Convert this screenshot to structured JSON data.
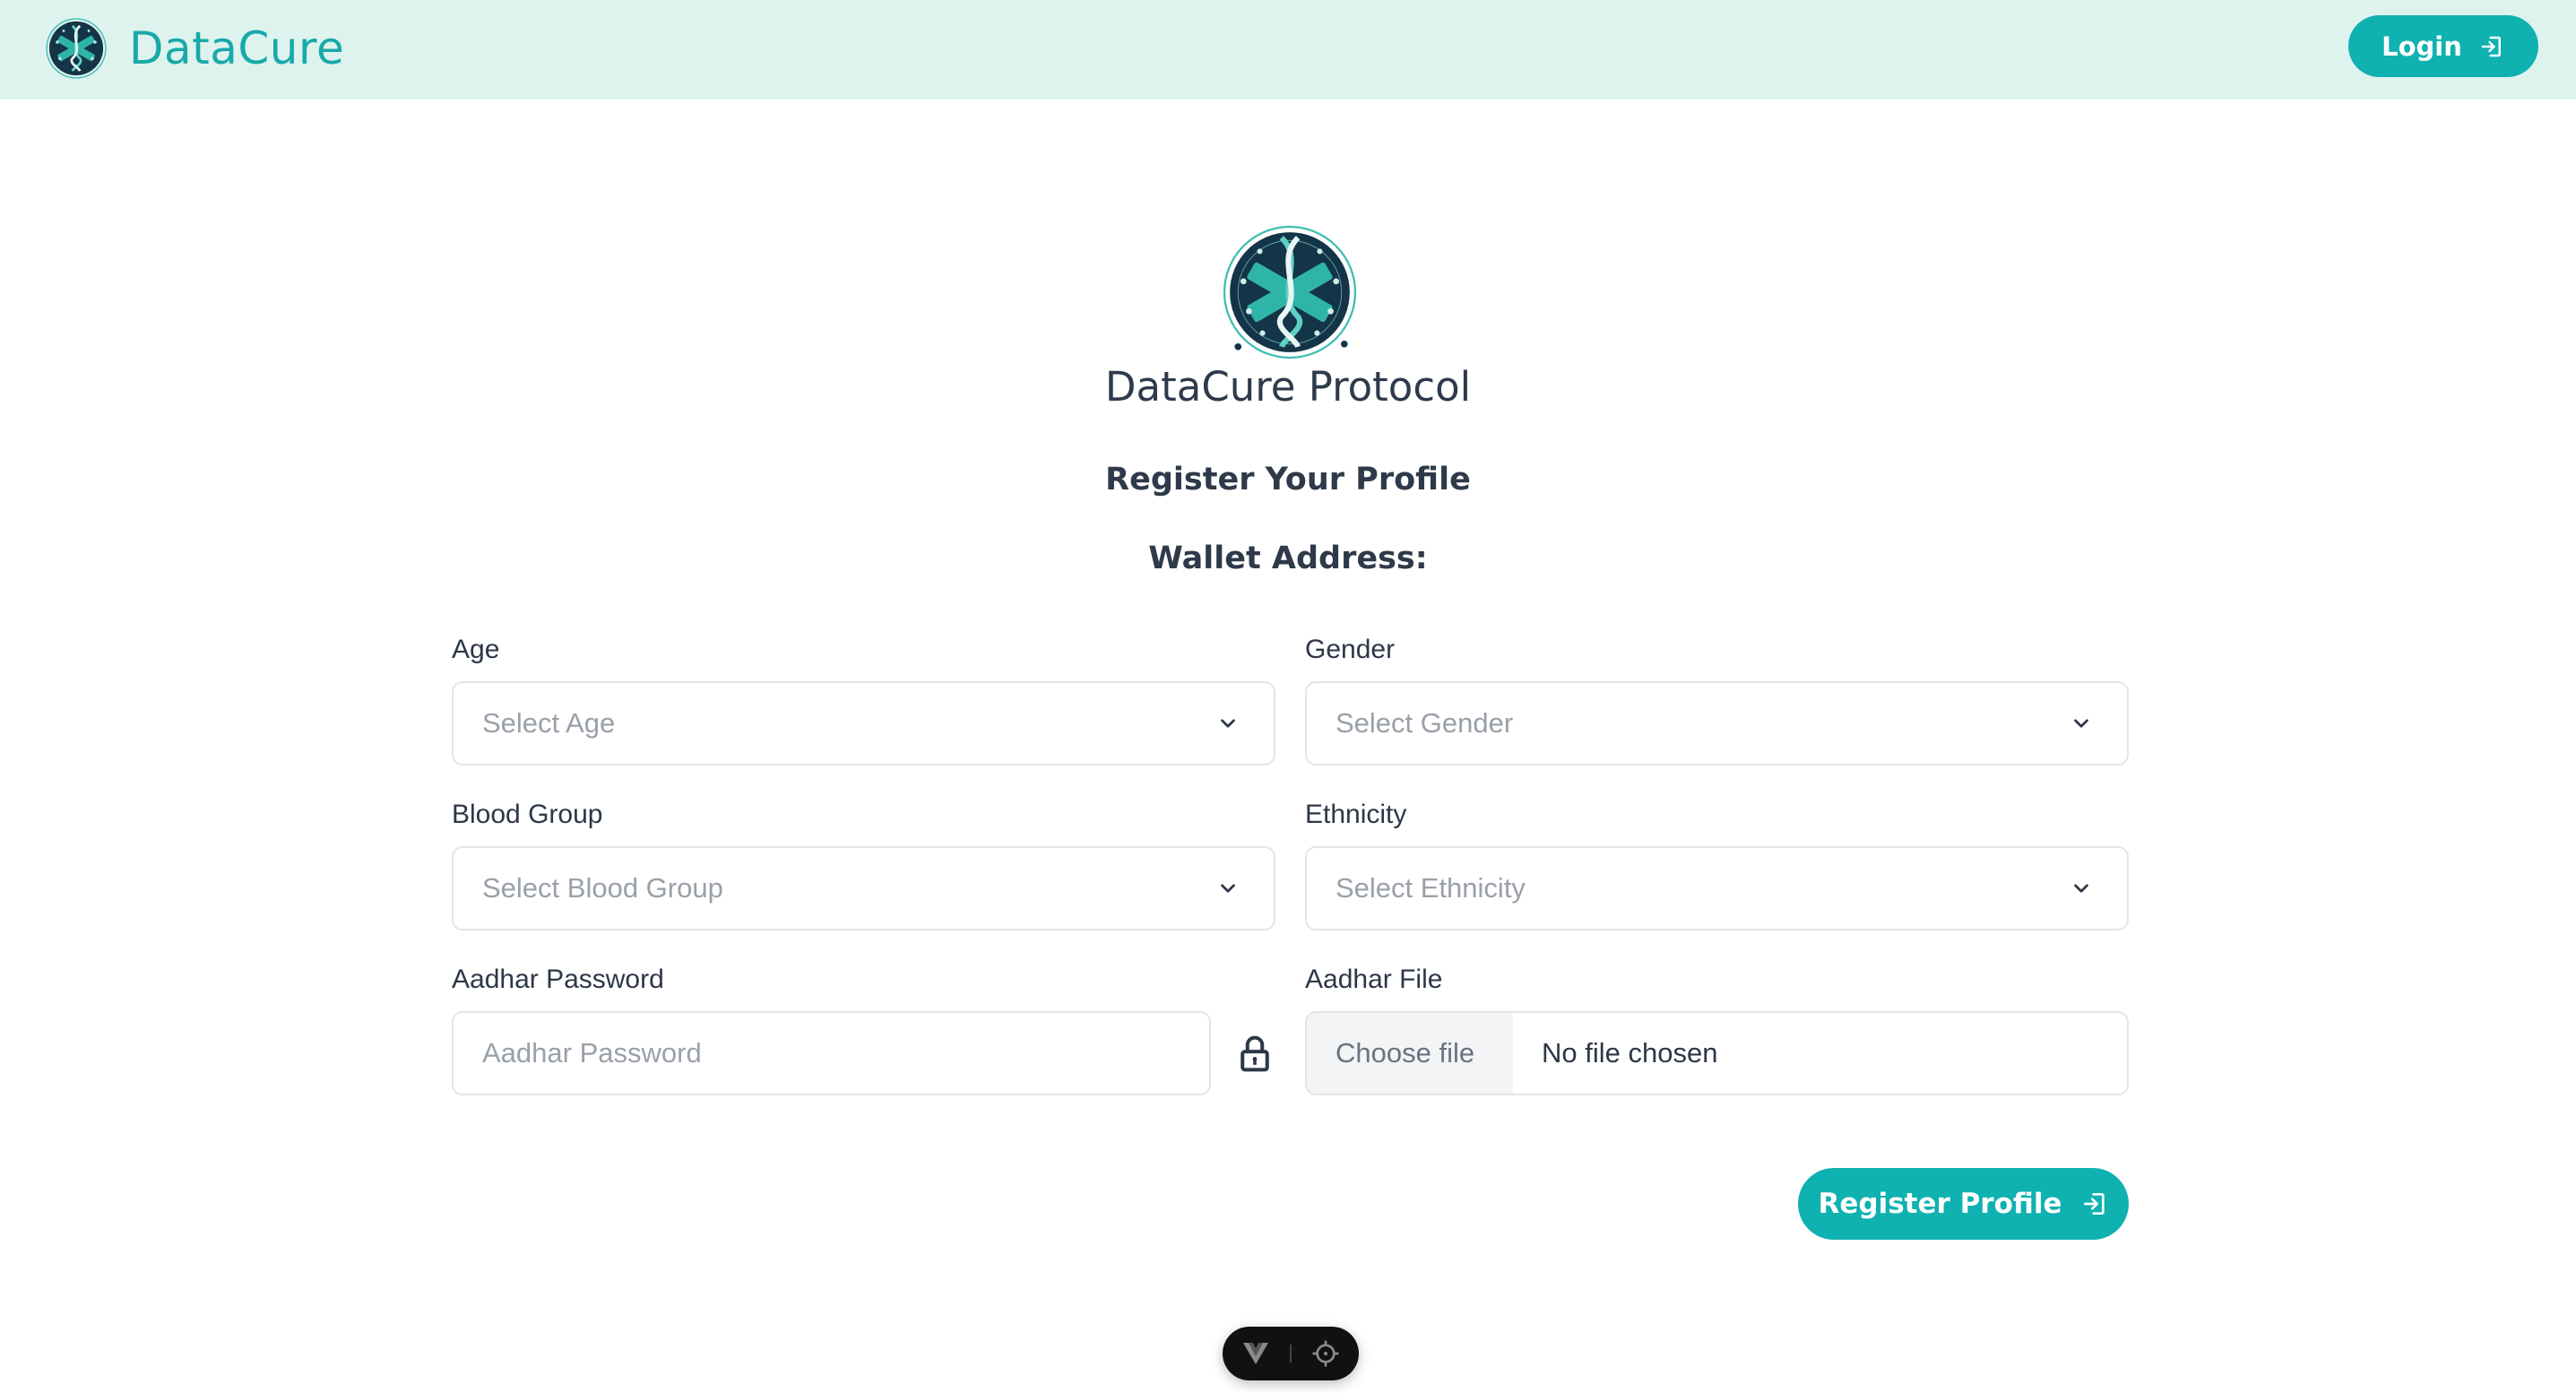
{
  "header": {
    "brand_name": "DataCure",
    "login_label": "Login",
    "brand_color": "#18a9a9",
    "background": "#def3ee"
  },
  "main": {
    "protocol_title": "DataCure Protocol",
    "register_title": "Register Your Profile",
    "wallet_label": "Wallet Address:",
    "wallet_value": ""
  },
  "form": {
    "age": {
      "label": "Age",
      "placeholder": "Select Age"
    },
    "gender": {
      "label": "Gender",
      "placeholder": "Select Gender"
    },
    "blood_group": {
      "label": "Blood Group",
      "placeholder": "Select Blood Group"
    },
    "ethnicity": {
      "label": "Ethnicity",
      "placeholder": "Select Ethnicity"
    },
    "aadhar_password": {
      "label": "Aadhar Password",
      "placeholder": "Aadhar Password",
      "value": ""
    },
    "aadhar_file": {
      "label": "Aadhar File",
      "button_label": "Choose file",
      "status": "No file chosen"
    },
    "submit_label": "Register Profile"
  },
  "icons": {
    "login": "login-arrow-icon",
    "register": "login-arrow-icon",
    "select": "chevron-down-icon",
    "password": "lock-icon",
    "devtools": [
      "vue-logo-icon",
      "crosshair-icon"
    ]
  },
  "colors": {
    "accent": "#0fb1b1",
    "text": "#2d3748",
    "placeholder": "#9aa0a9",
    "border": "#e3e5e8"
  }
}
